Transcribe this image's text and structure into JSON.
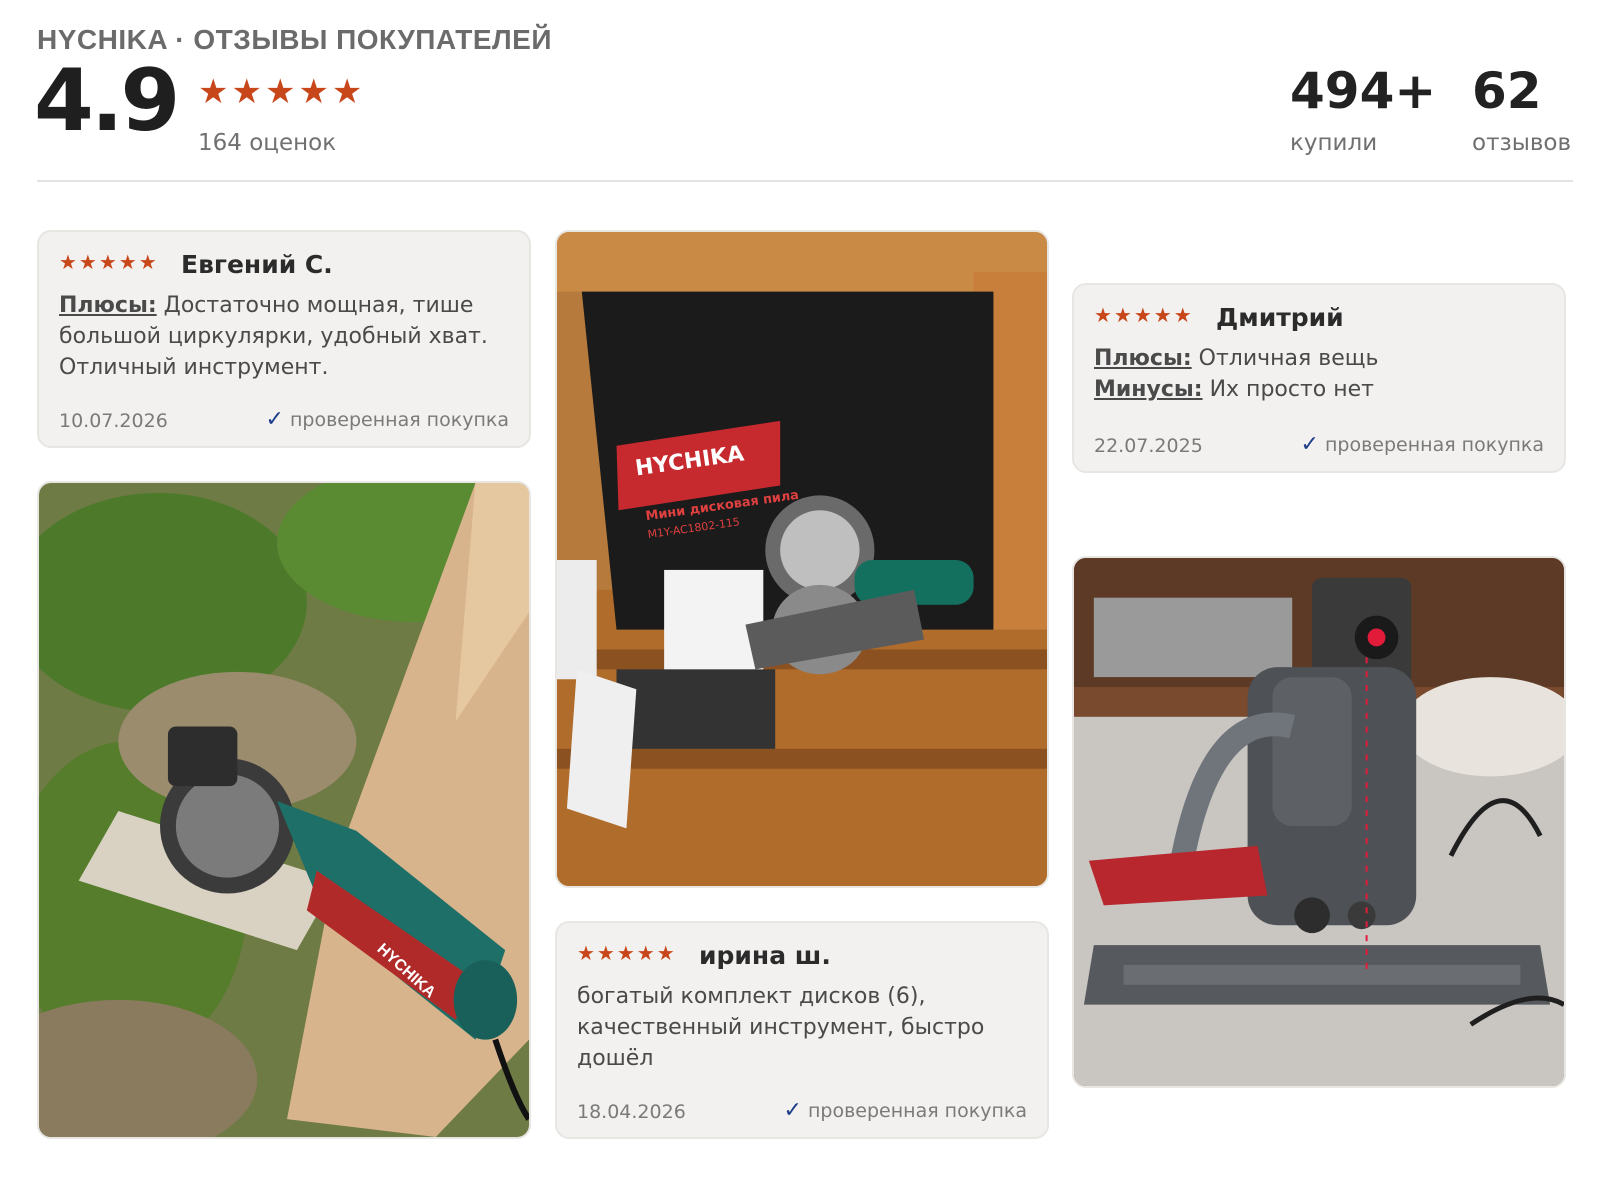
{
  "header": {
    "brand_title": "HYCHIKA · ОТЗЫВЫ ПОКУПАТЕЛЕЙ",
    "rating": "4.9",
    "stars": "★★★★★",
    "rating_count": "164 оценок",
    "bought_value": "494+",
    "bought_label": "купили",
    "reviews_value": "62",
    "reviews_label": "отзывов"
  },
  "reviews": [
    {
      "stars": "★★★★★",
      "author": "Евгений С.",
      "pros_label": "Плюсы:",
      "pros_text": " Достаточно мощная, тише большой циркулярки, удобный хват. Отличный инструмент.",
      "date": "10.07.2026",
      "verified": "проверенная покупка"
    },
    {
      "stars": "★★★★★",
      "author": "Дмитрий",
      "pros_label": "Плюсы:",
      "pros_text": " Отличная вещь",
      "cons_label": "Минусы:",
      "cons_text": " Их просто нет",
      "date": "22.07.2025",
      "verified": "проверенная покупка"
    },
    {
      "stars": "★★★★★",
      "author": "ирина ш.",
      "text": "богатый комплект дисков (6), качественный инструмент, быстро дошёл",
      "date": "18.04.2026",
      "verified": "проверенная покупка"
    }
  ],
  "photos": {
    "box_brand": "HYCHIKA",
    "box_subtitle": "Мини дисковая пила",
    "box_model": "M1Y-AC1802-115",
    "saw_label": "HYCHIKA"
  },
  "colors": {
    "star": "#c8471a",
    "card_bg": "#f2f1ef",
    "verified_check": "#1e3e8a"
  },
  "icons": {
    "check": "checkmark-icon",
    "star": "star-icon"
  }
}
